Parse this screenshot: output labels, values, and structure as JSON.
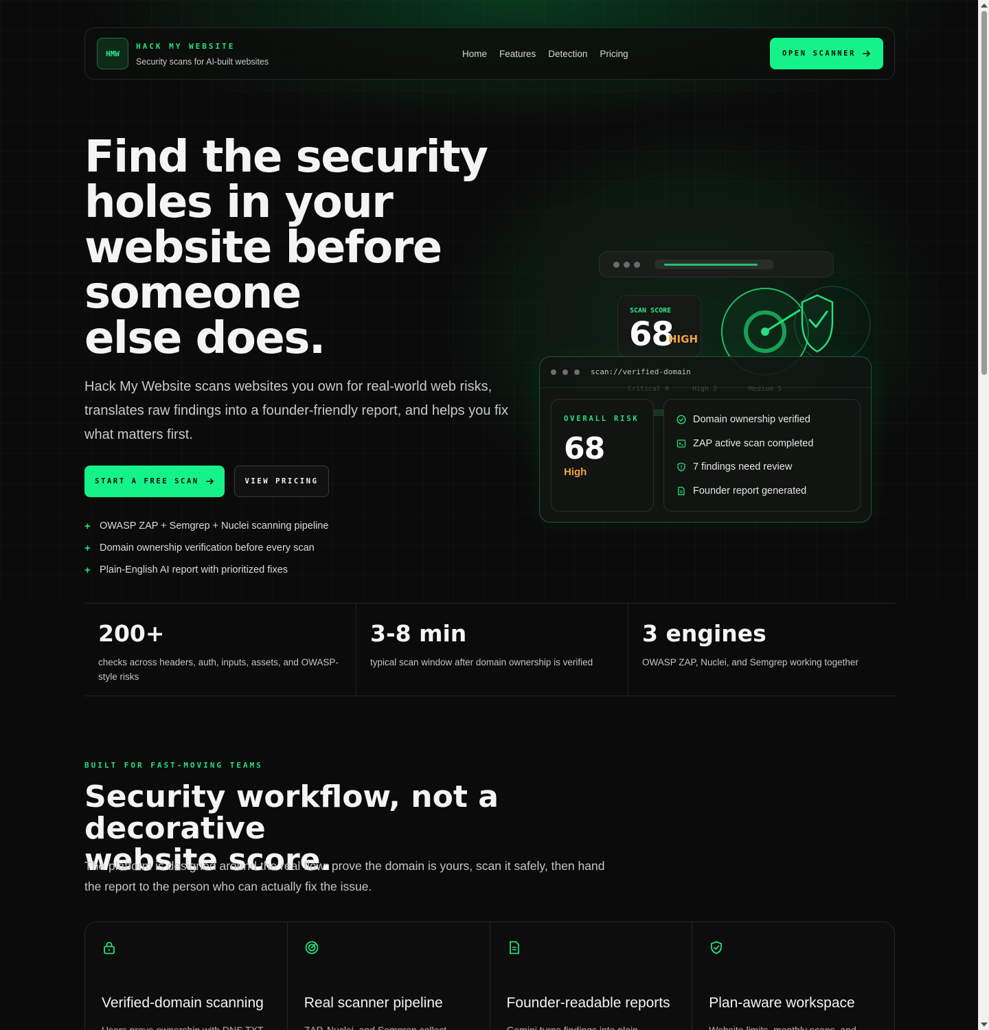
{
  "header": {
    "logo_text": "HMW",
    "brand_name": "HACK MY WEBSITE",
    "tagline": "Security scans for AI-built websites",
    "nav": [
      "Home",
      "Features",
      "Detection",
      "Pricing"
    ],
    "cta_label": "OPEN SCANNER"
  },
  "hero": {
    "title_lines": [
      "Find the security",
      "holes in your",
      "website before",
      "someone",
      "else does."
    ],
    "description": "Hack My Website scans websites you own for real-world web risks, translates raw findings into a founder-friendly report, and helps you fix what matters first.",
    "primary_button": "START A FREE SCAN",
    "secondary_button": "VIEW PRICING",
    "bullets": [
      "OWASP ZAP + Semgrep + Nuclei scanning pipeline",
      "Domain ownership verification before every scan",
      "Plain-English AI report with prioritized fixes"
    ]
  },
  "scan_visual": {
    "score_label": "SCAN SCORE",
    "score_value": "68",
    "score_severity": "HIGH",
    "url": "scan://verified-domain",
    "faint_labels": [
      "Critical 0",
      "High 2",
      "Medium 5"
    ],
    "risk_label": "OVERALL RISK",
    "risk_value": "68",
    "risk_severity": "High",
    "findings": [
      {
        "icon": "check-circle-icon",
        "text": "Domain ownership verified"
      },
      {
        "icon": "terminal-icon",
        "text": "ZAP active scan completed"
      },
      {
        "icon": "shield-alert-icon",
        "text": "7 findings need review"
      },
      {
        "icon": "file-text-icon",
        "text": "Founder report generated"
      }
    ],
    "colors": {
      "accent": "#15f28a",
      "severity_high": "#f3a341"
    }
  },
  "stats": [
    {
      "value": "200+",
      "description": "checks across headers, auth, inputs, assets, and OWASP-style risks"
    },
    {
      "value": "3-8 min",
      "description": "typical scan window after domain ownership is verified"
    },
    {
      "value": "3 engines",
      "description": "OWASP ZAP, Nuclei, and Semgrep working together"
    }
  ],
  "features_section": {
    "eyebrow": "BUILT FOR FAST-MOVING TEAMS",
    "title_lines": [
      "Security workflow, not a decorative",
      "website score."
    ],
    "description": "The platform is designed around the real flow: prove the domain is yours, scan it safely, then hand the report to the person who can actually fix the issue.",
    "cards": [
      {
        "icon": "lock-icon",
        "title": "Verified-domain scanning",
        "description": "Users prove ownership with DNS TXT"
      },
      {
        "icon": "radar-icon",
        "title": "Real scanner pipeline",
        "description": "ZAP, Nuclei, and Semgrep collect"
      },
      {
        "icon": "document-icon",
        "title": "Founder-readable reports",
        "description": "Gemini turns findings into plain"
      },
      {
        "icon": "shield-check-icon",
        "title": "Plan-aware workspace",
        "description": "Website limits, monthly scans, and"
      }
    ]
  }
}
